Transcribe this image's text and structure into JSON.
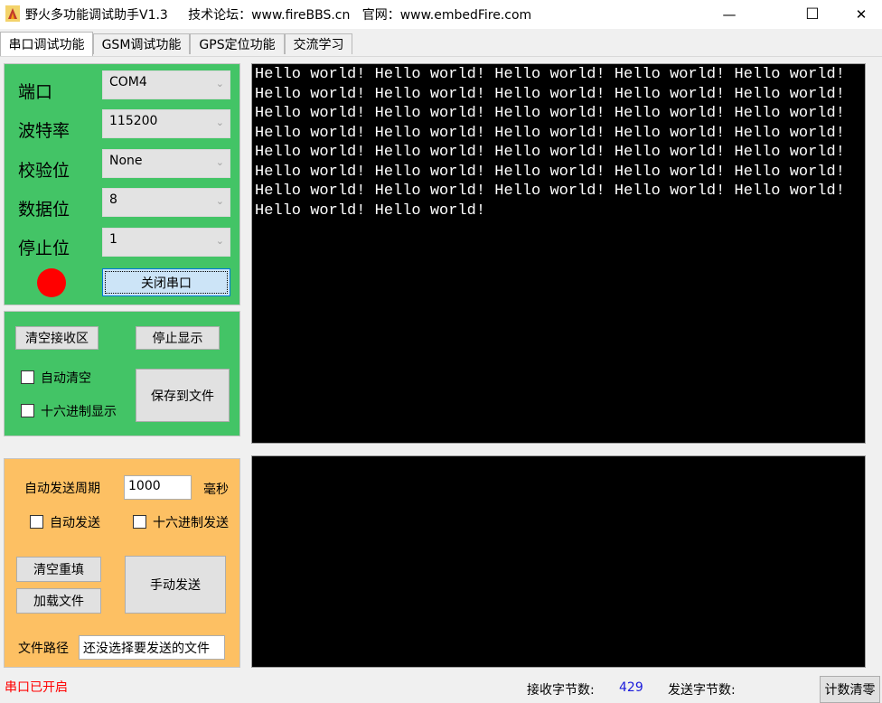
{
  "window": {
    "title": "野火多功能调试助手V1.3     技术论坛：www.fireBBS.cn   官网：www.embedFire.com",
    "minimize_symbol": "—",
    "maximize_symbol": "☐",
    "close_symbol": "✕"
  },
  "tabs": [
    {
      "label": "串口调试功能"
    },
    {
      "label": "GSM调试功能"
    },
    {
      "label": "GPS定位功能"
    },
    {
      "label": "交流学习"
    }
  ],
  "serial_settings": {
    "port_label": "端口",
    "port_value": "COM4",
    "baud_label": "波特率",
    "baud_value": "115200",
    "parity_label": "校验位",
    "parity_value": "None",
    "databits_label": "数据位",
    "databits_value": "8",
    "stopbits_label": "停止位",
    "stopbits_value": "1",
    "status_indicator_color": "#ff0000",
    "close_port_button": "关闭串口"
  },
  "receive_controls": {
    "clear_button": "清空接收区",
    "stop_display_button": "停止显示",
    "auto_clear_label": "自动清空",
    "hex_display_label": "十六进制显示",
    "save_file_button": "保存到文件"
  },
  "receive_area": {
    "text": "Hello world! Hello world! Hello world! Hello world! Hello world! Hello world! Hello world! Hello world! Hello world! Hello world! Hello world! Hello world! Hello world! Hello world! Hello world! Hello world! Hello world! Hello world! Hello world! Hello world! Hello world! Hello world! Hello world! Hello world! Hello world! Hello world! Hello world! Hello world! Hello world! Hello world! Hello world! Hello world! Hello world! Hello world! Hello world! Hello world! Hello world!"
  },
  "send_controls": {
    "period_label": "自动发送周期",
    "period_value": "1000",
    "period_unit": "毫秒",
    "auto_send_label": "自动发送",
    "hex_send_label": "十六进制发送",
    "clear_refill_button": "清空重填",
    "load_file_button": "加载文件",
    "manual_send_button": "手动发送",
    "file_path_label": "文件路径",
    "file_path_value": "还没选择要发送的文件"
  },
  "status_bar": {
    "port_status": "串口已开启",
    "rx_label": "接收字节数:",
    "rx_count": "429",
    "tx_label": "发送字节数:",
    "tx_count": "",
    "reset_count_button": "计数清零"
  },
  "colors": {
    "green_panel": "#43c466",
    "orange_panel": "#fdc063",
    "status_text": "#ff0000",
    "rx_count": "#1a1adb"
  }
}
